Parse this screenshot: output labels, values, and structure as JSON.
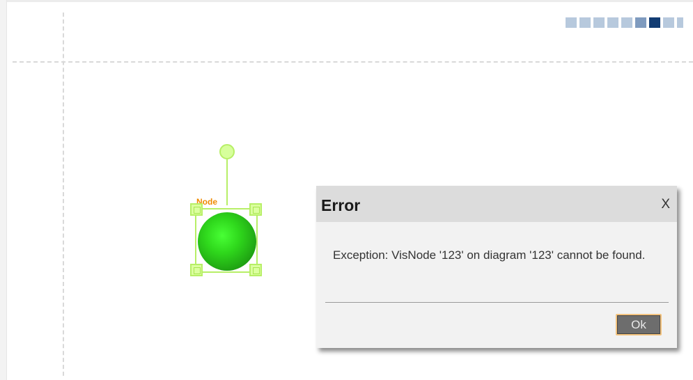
{
  "diagram": {
    "node": {
      "label": "Node",
      "fill_color": "#33cc22",
      "selection_color": "#b7ef66",
      "label_color": "#ef8a00"
    },
    "pager": {
      "square_count": 8,
      "active_index": 6
    }
  },
  "error_dialog": {
    "title": "Error",
    "close_label": "X",
    "message": "Exception: VisNode '123' on diagram '123' cannot be found.",
    "ok_label": "Ok"
  }
}
